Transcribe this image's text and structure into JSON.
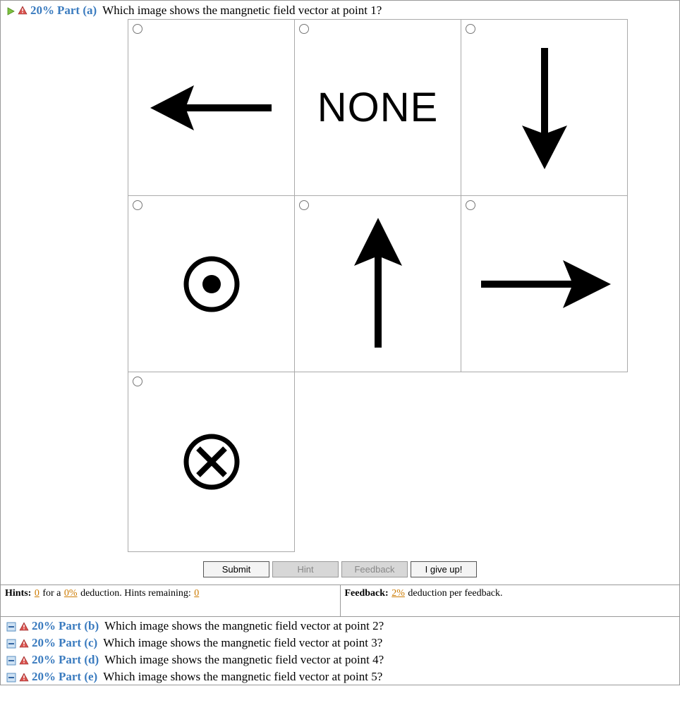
{
  "part_a": {
    "percent": "20%",
    "label": "Part (a)",
    "question": "Which image shows the mangnetic field vector at point 1?",
    "options": {
      "none_text": "NONE"
    }
  },
  "buttons": {
    "submit": "Submit",
    "hint": "Hint",
    "feedback": "Feedback",
    "giveup": "I give up!"
  },
  "hints_info": {
    "label": "Hints:",
    "used": "0",
    "mid1": " for a ",
    "deduction": "0%",
    "mid2": " deduction. Hints remaining: ",
    "remaining": "0"
  },
  "feedback_info": {
    "label": "Feedback:",
    "deduction": "2%",
    "suffix": " deduction per feedback."
  },
  "other_parts": [
    {
      "percent": "20%",
      "label": "Part (b)",
      "question": "Which image shows the mangnetic field vector at point 2?"
    },
    {
      "percent": "20%",
      "label": "Part (c)",
      "question": "Which image shows the mangnetic field vector at point 3?"
    },
    {
      "percent": "20%",
      "label": "Part (d)",
      "question": "Which image shows the mangnetic field vector at point 4?"
    },
    {
      "percent": "20%",
      "label": "Part (e)",
      "question": "Which image shows the mangnetic field vector at point 5?"
    }
  ]
}
